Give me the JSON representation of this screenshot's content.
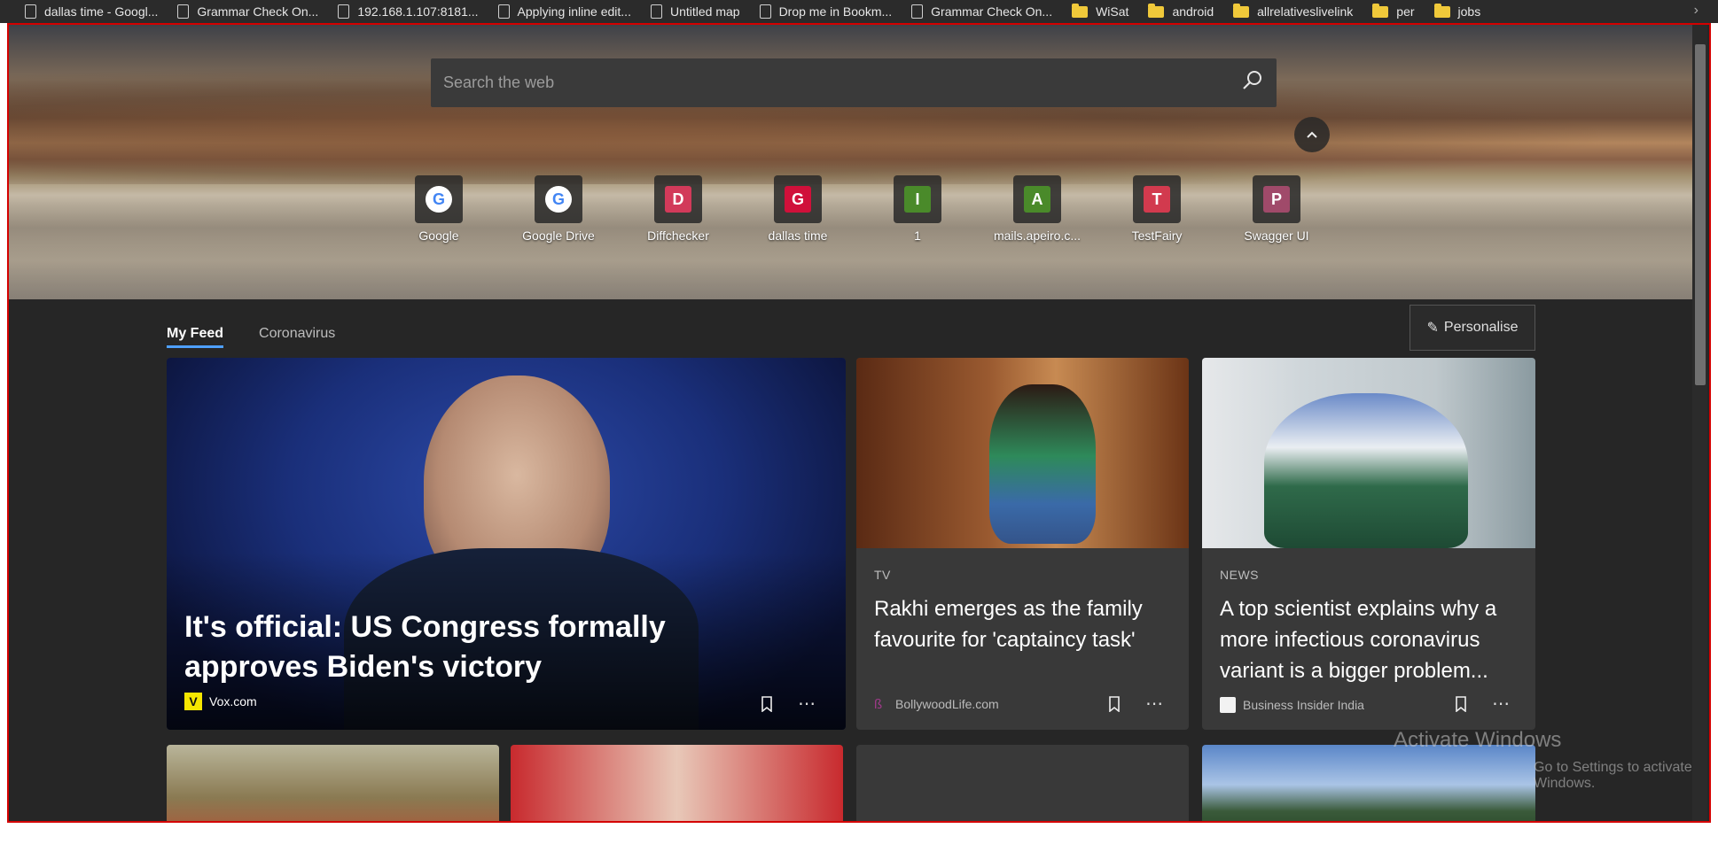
{
  "bookmarks": {
    "items": [
      {
        "label": "dallas time - Googl...",
        "type": "page"
      },
      {
        "label": "Grammar Check On...",
        "type": "page"
      },
      {
        "label": "192.168.1.107:8181...",
        "type": "page"
      },
      {
        "label": "Applying inline edit...",
        "type": "page"
      },
      {
        "label": "Untitled map",
        "type": "page"
      },
      {
        "label": "Drop me in Bookm...",
        "type": "page"
      },
      {
        "label": "Grammar Check On...",
        "type": "page"
      },
      {
        "label": "WiSat",
        "type": "folder"
      },
      {
        "label": "android",
        "type": "folder"
      },
      {
        "label": "allrelativeslivelink",
        "type": "folder"
      },
      {
        "label": "per",
        "type": "folder"
      },
      {
        "label": "jobs",
        "type": "folder"
      }
    ],
    "more_icon": "chevron-right-icon"
  },
  "search": {
    "placeholder": "Search the web",
    "icon": "search-icon"
  },
  "quick_links": [
    {
      "label": "Google",
      "letter": "G",
      "kind": "google"
    },
    {
      "label": "Google Drive",
      "letter": "G",
      "kind": "google"
    },
    {
      "label": "Diffchecker",
      "letter": "D",
      "color": "#d23a5a"
    },
    {
      "label": "dallas time",
      "letter": "G",
      "color": "#d0103a"
    },
    {
      "label": "1",
      "letter": "I",
      "color": "#4a8a2a"
    },
    {
      "label": "mails.apeiro.c...",
      "letter": "A",
      "color": "#4a8a2a"
    },
    {
      "label": "TestFairy",
      "letter": "T",
      "color": "#d23a4e"
    },
    {
      "label": "Swagger UI",
      "letter": "P",
      "color": "#a04a6a"
    }
  ],
  "feed": {
    "tabs": [
      "My Feed",
      "Coronavirus"
    ],
    "active_tab": "My Feed",
    "personalise_label": "Personalise"
  },
  "cards": {
    "main": {
      "title": "It's official: US Congress formally approves Biden's victory",
      "source": "Vox.com",
      "source_logo": "V"
    },
    "tv": {
      "category": "TV",
      "title": "Rakhi emerges as the family favourite for 'captaincy task'",
      "source": "BollywoodLife.com"
    },
    "news": {
      "category": "NEWS",
      "title": "A top scientist explains why a more infectious coronavirus variant is a bigger problem...",
      "source": "Business Insider India"
    },
    "more_label": "⋯"
  },
  "watermark": {
    "line1": "Activate Windows",
    "line2": "Go to Settings to activate Windows."
  },
  "colors": {
    "accent": "#4ea0ff",
    "frame_border": "#d40000"
  }
}
